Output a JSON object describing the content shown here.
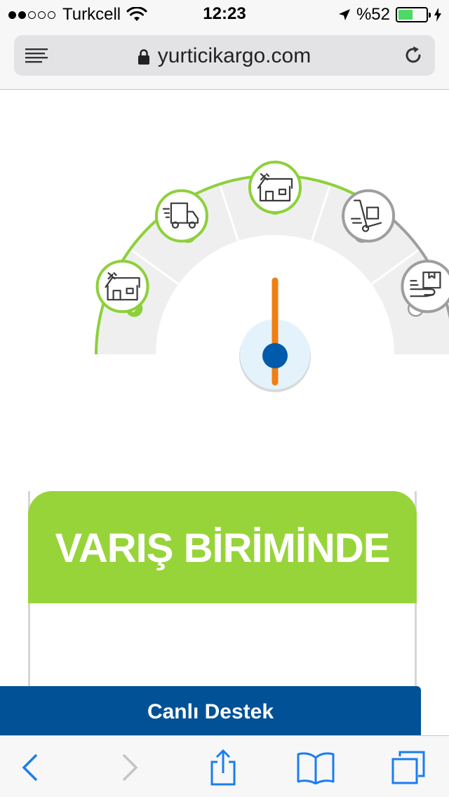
{
  "status_bar": {
    "carrier": "Turkcell",
    "time": "12:23",
    "battery_text": "%52",
    "battery_level": 0.52,
    "signal_bars_filled": 2,
    "signal_bars_total": 5
  },
  "browser": {
    "url": "yurticikargo.com",
    "icons": {
      "menu": "reader-menu-icon",
      "secure": "lock-icon",
      "reload": "reload-icon"
    }
  },
  "tracker": {
    "colors": {
      "done": "#8dd03a",
      "pending": "#9e9e9e",
      "needle": "#f07f13",
      "hub": "#005bab",
      "hub_halo": "#e4f3fb"
    },
    "stages": [
      {
        "icon": "warehouse-icon",
        "status": "done"
      },
      {
        "icon": "delivery-truck-icon",
        "status": "done"
      },
      {
        "icon": "warehouse-icon",
        "status": "done"
      },
      {
        "icon": "hand-truck-icon",
        "status": "pending"
      },
      {
        "icon": "package-delivered-icon",
        "status": "pending"
      }
    ]
  },
  "card": {
    "title": "VARIŞ BİRİMİNDE",
    "header_color": "#97d43a"
  },
  "live_support": {
    "label": "Canlı Destek",
    "color": "#005196"
  },
  "toolbar": {
    "accent": "#1a7cf4",
    "disabled": "#c4c4c4",
    "buttons": [
      {
        "icon": "back-icon",
        "enabled": true
      },
      {
        "icon": "forward-icon",
        "enabled": false
      },
      {
        "icon": "share-icon",
        "enabled": true
      },
      {
        "icon": "bookmarks-icon",
        "enabled": true
      },
      {
        "icon": "tabs-icon",
        "enabled": true
      }
    ]
  }
}
